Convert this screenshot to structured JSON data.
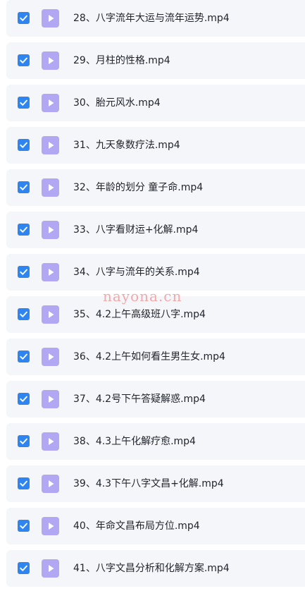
{
  "colors": {
    "accent": "#2f84ef",
    "file_icon": "#b1a7f3",
    "row_background": "#f5f6fa",
    "text": "#1f2329",
    "watermark": "#f29a9a"
  },
  "icons": {
    "checkbox": "checkmark-icon",
    "file": "video-play-icon"
  },
  "files": [
    {
      "name": "28、八字流年大运与流年运势.mp4",
      "checked": true
    },
    {
      "name": "29、月柱的性格.mp4",
      "checked": true
    },
    {
      "name": "30、胎元风水.mp4",
      "checked": true
    },
    {
      "name": "31、九天象数疗法.mp4",
      "checked": true
    },
    {
      "name": "32、年龄的划分 童子命.mp4",
      "checked": true
    },
    {
      "name": "33、八字看财运+化解.mp4",
      "checked": true
    },
    {
      "name": "34、八字与流年的关系.mp4",
      "checked": true
    },
    {
      "name": "35、4.2上午高级班八字.mp4",
      "checked": true
    },
    {
      "name": "36、4.2上午如何看生男生女.mp4",
      "checked": true
    },
    {
      "name": "37、4.2号下午答疑解惑.mp4",
      "checked": true
    },
    {
      "name": "38、4.3上午化解疗愈.mp4",
      "checked": true
    },
    {
      "name": "39、4.3下午八字文昌+化解.mp4",
      "checked": true
    },
    {
      "name": "40、年命文昌布局方位.mp4",
      "checked": true
    },
    {
      "name": "41、八字文昌分析和化解方案.mp4",
      "checked": true
    }
  ],
  "watermark": "nayona.cn"
}
